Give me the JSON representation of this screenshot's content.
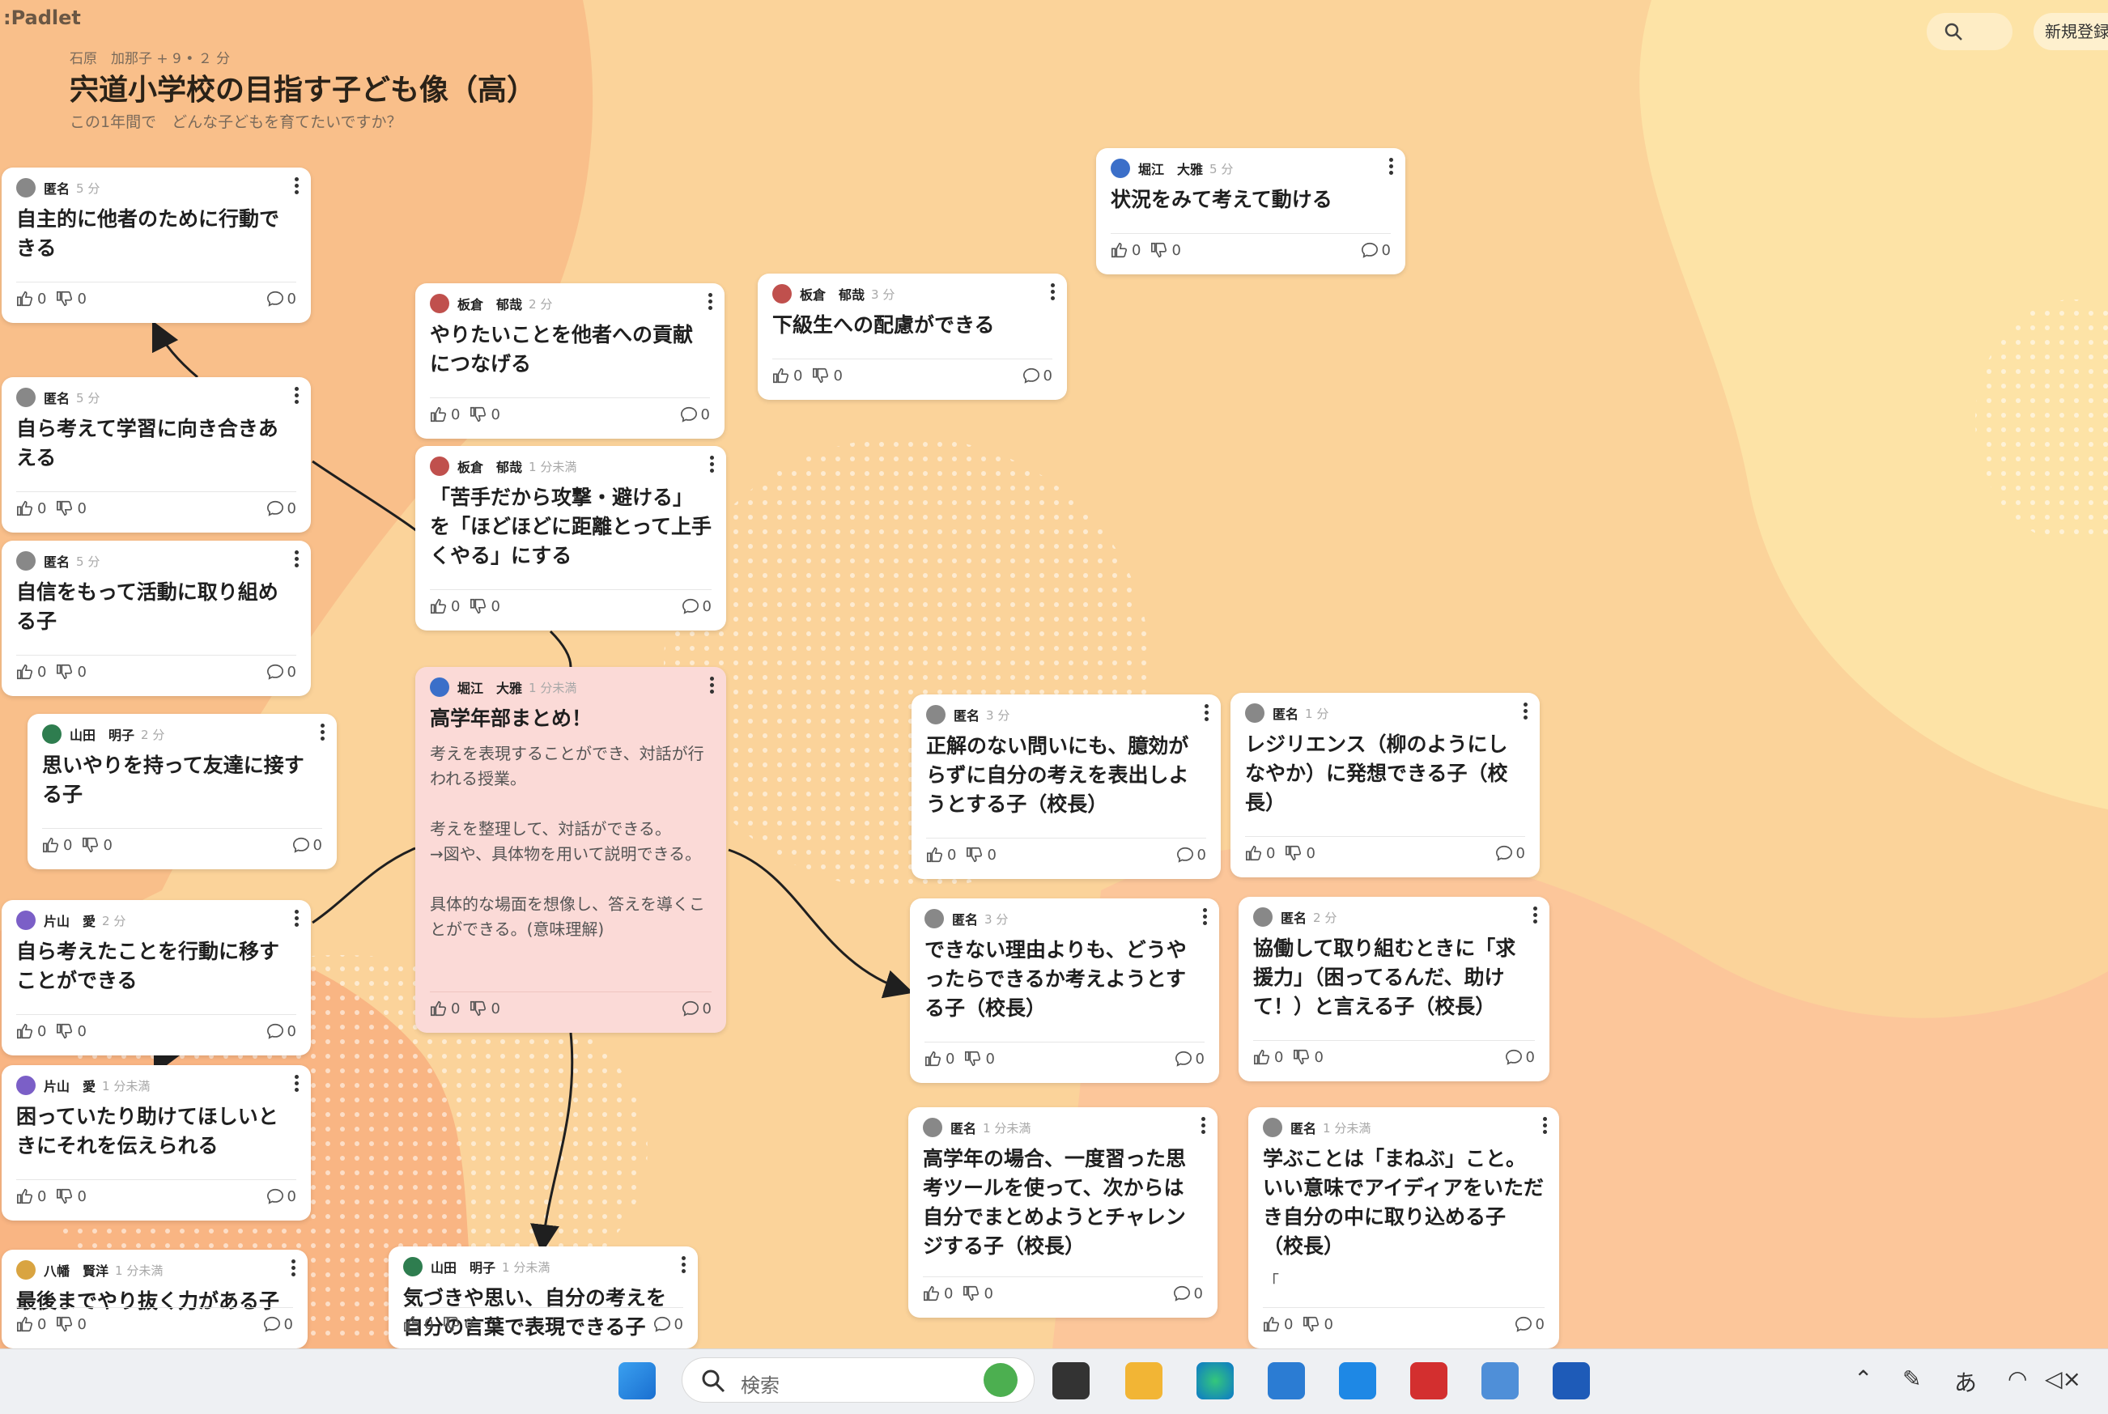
{
  "app": {
    "logo": ":Padlet",
    "search_icon": "search-icon",
    "signup_label": "新規登録"
  },
  "header": {
    "meta": "石原　加那子 + 9 • ２ 分",
    "title": "宍道小学校の目指す子ども像（高）",
    "subtitle": "この1年間で　どんな子どもを育てたいですか？"
  },
  "cards": [
    {
      "id": "c1",
      "author": "匿名",
      "time": "5 分",
      "body": "自主的に他者のために行動できる",
      "likes": "0",
      "dislikes": "0",
      "comments": "0",
      "avatar": "#888888"
    },
    {
      "id": "c2",
      "author": "匿名",
      "time": "5 分",
      "body": "自ら考えて学習に向き合きあえる",
      "likes": "0",
      "dislikes": "0",
      "comments": "0",
      "avatar": "#888888"
    },
    {
      "id": "c3",
      "author": "匿名",
      "time": "5 分",
      "body": "自信をもって活動に取り組める子",
      "likes": "0",
      "dislikes": "0",
      "comments": "0",
      "avatar": "#888888"
    },
    {
      "id": "c4",
      "author": "山田　明子",
      "time": "2 分",
      "body": "思いやりを持って友達に接する子",
      "likes": "0",
      "dislikes": "0",
      "comments": "0",
      "avatar": "#2e7d4f"
    },
    {
      "id": "c5",
      "author": "片山　愛",
      "time": "2 分",
      "body": "自ら考えたことを行動に移すことができる",
      "likes": "0",
      "dislikes": "0",
      "comments": "0",
      "avatar": "#7b5fc7"
    },
    {
      "id": "c6",
      "author": "片山　愛",
      "time": "1 分未満",
      "body": "困っていたり助けてほしいときにそれを伝えられる",
      "likes": "0",
      "dislikes": "0",
      "comments": "0",
      "avatar": "#7b5fc7"
    },
    {
      "id": "c7",
      "author": "八幡　賢洋",
      "time": "1 分未満",
      "body": "最後までやり抜く力がある子",
      "likes": "0",
      "dislikes": "0",
      "comments": "0",
      "avatar": "#d9a441"
    },
    {
      "id": "c8",
      "author": "板倉　郁哉",
      "time": "2 分",
      "body": "やりたいことを他者への貢献につなげる",
      "likes": "0",
      "dislikes": "0",
      "comments": "0",
      "avatar": "#c0504d"
    },
    {
      "id": "c9",
      "author": "板倉　郁哉",
      "time": "1 分未満",
      "body": "「苦手だから攻撃・避ける」を「ほどほどに距離とって上手くやる」にする",
      "likes": "0",
      "dislikes": "0",
      "comments": "0",
      "avatar": "#c0504d"
    },
    {
      "id": "c10",
      "author": "堀江　大雅",
      "time": "1 分未満",
      "body": "高学年部まとめ！",
      "detail": "考えを表現することができ、対話が行われる授業。\n\n考えを整理して、対話ができる。\n→図や、具体物を用いて説明できる。\n\n具体的な場面を想像し、答えを導くことができる。(意味理解)",
      "likes": "0",
      "dislikes": "0",
      "comments": "0",
      "avatar": "#3b6fc9"
    },
    {
      "id": "c11",
      "author": "山田　明子",
      "time": "1 分未満",
      "body": "気づきや思い、自分の考えを自分の言葉で表現できる子",
      "likes": "0",
      "dislikes": "0",
      "comments": "0",
      "avatar": "#2e7d4f"
    },
    {
      "id": "c12",
      "author": "板倉　郁哉",
      "time": "3 分",
      "body": "下級生への配慮ができる",
      "likes": "0",
      "dislikes": "0",
      "comments": "0",
      "avatar": "#c0504d"
    },
    {
      "id": "c13",
      "author": "堀江　大雅",
      "time": "5 分",
      "body": "状況をみて考えて動ける",
      "likes": "0",
      "dislikes": "0",
      "comments": "0",
      "avatar": "#3b6fc9"
    },
    {
      "id": "c14",
      "author": "匿名",
      "time": "3 分",
      "body": "正解のない問いにも、臆効がらずに自分の考えを表出しようとする子（校長）",
      "likes": "0",
      "dislikes": "0",
      "comments": "0",
      "avatar": "#888888"
    },
    {
      "id": "c15",
      "author": "匿名",
      "time": "1 分",
      "body": "レジリエンス（柳のようにしなやか）に発想できる子（校長）",
      "likes": "0",
      "dislikes": "0",
      "comments": "0",
      "avatar": "#888888"
    },
    {
      "id": "c16",
      "author": "匿名",
      "time": "3 分",
      "body": "できない理由よりも、どうやったらできるか考えようとする子（校長）",
      "likes": "0",
      "dislikes": "0",
      "comments": "0",
      "avatar": "#888888"
    },
    {
      "id": "c17",
      "author": "匿名",
      "time": "2 分",
      "body": "協働して取り組むときに「求援力」（困ってるんだ、助けて！）と言える子（校長）",
      "likes": "0",
      "dislikes": "0",
      "comments": "0",
      "avatar": "#888888"
    },
    {
      "id": "c18",
      "author": "匿名",
      "time": "1 分未満",
      "body": "高学年の場合、一度習った思考ツールを使って、次からは自分でまとめようとチャレンジする子（校長）",
      "likes": "0",
      "dislikes": "0",
      "comments": "0",
      "avatar": "#888888"
    },
    {
      "id": "c19",
      "author": "匿名",
      "time": "1 分未満",
      "body": "学ぶことは「まねぶ」こと。いい意味でアイディアをいただき自分の中に取り込める子（校長）",
      "detail": "「",
      "likes": "0",
      "dislikes": "0",
      "comments": "0",
      "avatar": "#888888"
    }
  ],
  "taskbar": {
    "search_placeholder": "検索",
    "ime_label": "あ",
    "icons": [
      "windows-start-icon",
      "task-view-icon",
      "file-explorer-icon",
      "edge-browser-icon",
      "teams-icon",
      "3d-viewer-icon",
      "acrobat-icon",
      "notepad-icon",
      "word-icon"
    ]
  },
  "colors": {
    "background": "#fbd39a",
    "card": "#ffffff",
    "highlight_card": "#fbdad7",
    "connector": "#1f1f1f"
  }
}
